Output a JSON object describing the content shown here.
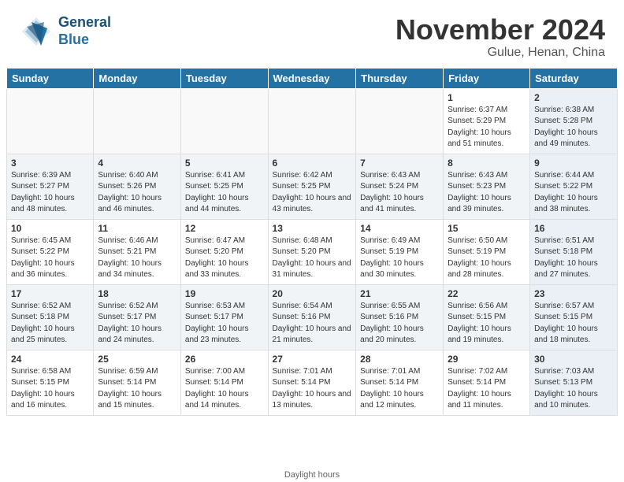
{
  "header": {
    "logo_text_general": "General",
    "logo_text_blue": "Blue",
    "month_year": "November 2024",
    "location": "Gulue, Henan, China"
  },
  "weekdays": [
    "Sunday",
    "Monday",
    "Tuesday",
    "Wednesday",
    "Thursday",
    "Friday",
    "Saturday"
  ],
  "weeks": [
    [
      {
        "day": "",
        "info": ""
      },
      {
        "day": "",
        "info": ""
      },
      {
        "day": "",
        "info": ""
      },
      {
        "day": "",
        "info": ""
      },
      {
        "day": "",
        "info": ""
      },
      {
        "day": "1",
        "info": "Sunrise: 6:37 AM\nSunset: 5:29 PM\nDaylight: 10 hours and 51 minutes."
      },
      {
        "day": "2",
        "info": "Sunrise: 6:38 AM\nSunset: 5:28 PM\nDaylight: 10 hours and 49 minutes."
      }
    ],
    [
      {
        "day": "3",
        "info": "Sunrise: 6:39 AM\nSunset: 5:27 PM\nDaylight: 10 hours and 48 minutes."
      },
      {
        "day": "4",
        "info": "Sunrise: 6:40 AM\nSunset: 5:26 PM\nDaylight: 10 hours and 46 minutes."
      },
      {
        "day": "5",
        "info": "Sunrise: 6:41 AM\nSunset: 5:25 PM\nDaylight: 10 hours and 44 minutes."
      },
      {
        "day": "6",
        "info": "Sunrise: 6:42 AM\nSunset: 5:25 PM\nDaylight: 10 hours and 43 minutes."
      },
      {
        "day": "7",
        "info": "Sunrise: 6:43 AM\nSunset: 5:24 PM\nDaylight: 10 hours and 41 minutes."
      },
      {
        "day": "8",
        "info": "Sunrise: 6:43 AM\nSunset: 5:23 PM\nDaylight: 10 hours and 39 minutes."
      },
      {
        "day": "9",
        "info": "Sunrise: 6:44 AM\nSunset: 5:22 PM\nDaylight: 10 hours and 38 minutes."
      }
    ],
    [
      {
        "day": "10",
        "info": "Sunrise: 6:45 AM\nSunset: 5:22 PM\nDaylight: 10 hours and 36 minutes."
      },
      {
        "day": "11",
        "info": "Sunrise: 6:46 AM\nSunset: 5:21 PM\nDaylight: 10 hours and 34 minutes."
      },
      {
        "day": "12",
        "info": "Sunrise: 6:47 AM\nSunset: 5:20 PM\nDaylight: 10 hours and 33 minutes."
      },
      {
        "day": "13",
        "info": "Sunrise: 6:48 AM\nSunset: 5:20 PM\nDaylight: 10 hours and 31 minutes."
      },
      {
        "day": "14",
        "info": "Sunrise: 6:49 AM\nSunset: 5:19 PM\nDaylight: 10 hours and 30 minutes."
      },
      {
        "day": "15",
        "info": "Sunrise: 6:50 AM\nSunset: 5:19 PM\nDaylight: 10 hours and 28 minutes."
      },
      {
        "day": "16",
        "info": "Sunrise: 6:51 AM\nSunset: 5:18 PM\nDaylight: 10 hours and 27 minutes."
      }
    ],
    [
      {
        "day": "17",
        "info": "Sunrise: 6:52 AM\nSunset: 5:18 PM\nDaylight: 10 hours and 25 minutes."
      },
      {
        "day": "18",
        "info": "Sunrise: 6:52 AM\nSunset: 5:17 PM\nDaylight: 10 hours and 24 minutes."
      },
      {
        "day": "19",
        "info": "Sunrise: 6:53 AM\nSunset: 5:17 PM\nDaylight: 10 hours and 23 minutes."
      },
      {
        "day": "20",
        "info": "Sunrise: 6:54 AM\nSunset: 5:16 PM\nDaylight: 10 hours and 21 minutes."
      },
      {
        "day": "21",
        "info": "Sunrise: 6:55 AM\nSunset: 5:16 PM\nDaylight: 10 hours and 20 minutes."
      },
      {
        "day": "22",
        "info": "Sunrise: 6:56 AM\nSunset: 5:15 PM\nDaylight: 10 hours and 19 minutes."
      },
      {
        "day": "23",
        "info": "Sunrise: 6:57 AM\nSunset: 5:15 PM\nDaylight: 10 hours and 18 minutes."
      }
    ],
    [
      {
        "day": "24",
        "info": "Sunrise: 6:58 AM\nSunset: 5:15 PM\nDaylight: 10 hours and 16 minutes."
      },
      {
        "day": "25",
        "info": "Sunrise: 6:59 AM\nSunset: 5:14 PM\nDaylight: 10 hours and 15 minutes."
      },
      {
        "day": "26",
        "info": "Sunrise: 7:00 AM\nSunset: 5:14 PM\nDaylight: 10 hours and 14 minutes."
      },
      {
        "day": "27",
        "info": "Sunrise: 7:01 AM\nSunset: 5:14 PM\nDaylight: 10 hours and 13 minutes."
      },
      {
        "day": "28",
        "info": "Sunrise: 7:01 AM\nSunset: 5:14 PM\nDaylight: 10 hours and 12 minutes."
      },
      {
        "day": "29",
        "info": "Sunrise: 7:02 AM\nSunset: 5:14 PM\nDaylight: 10 hours and 11 minutes."
      },
      {
        "day": "30",
        "info": "Sunrise: 7:03 AM\nSunset: 5:13 PM\nDaylight: 10 hours and 10 minutes."
      }
    ]
  ],
  "footer": {
    "text": "Daylight hours",
    "url": "https://www.generalblue.com"
  }
}
